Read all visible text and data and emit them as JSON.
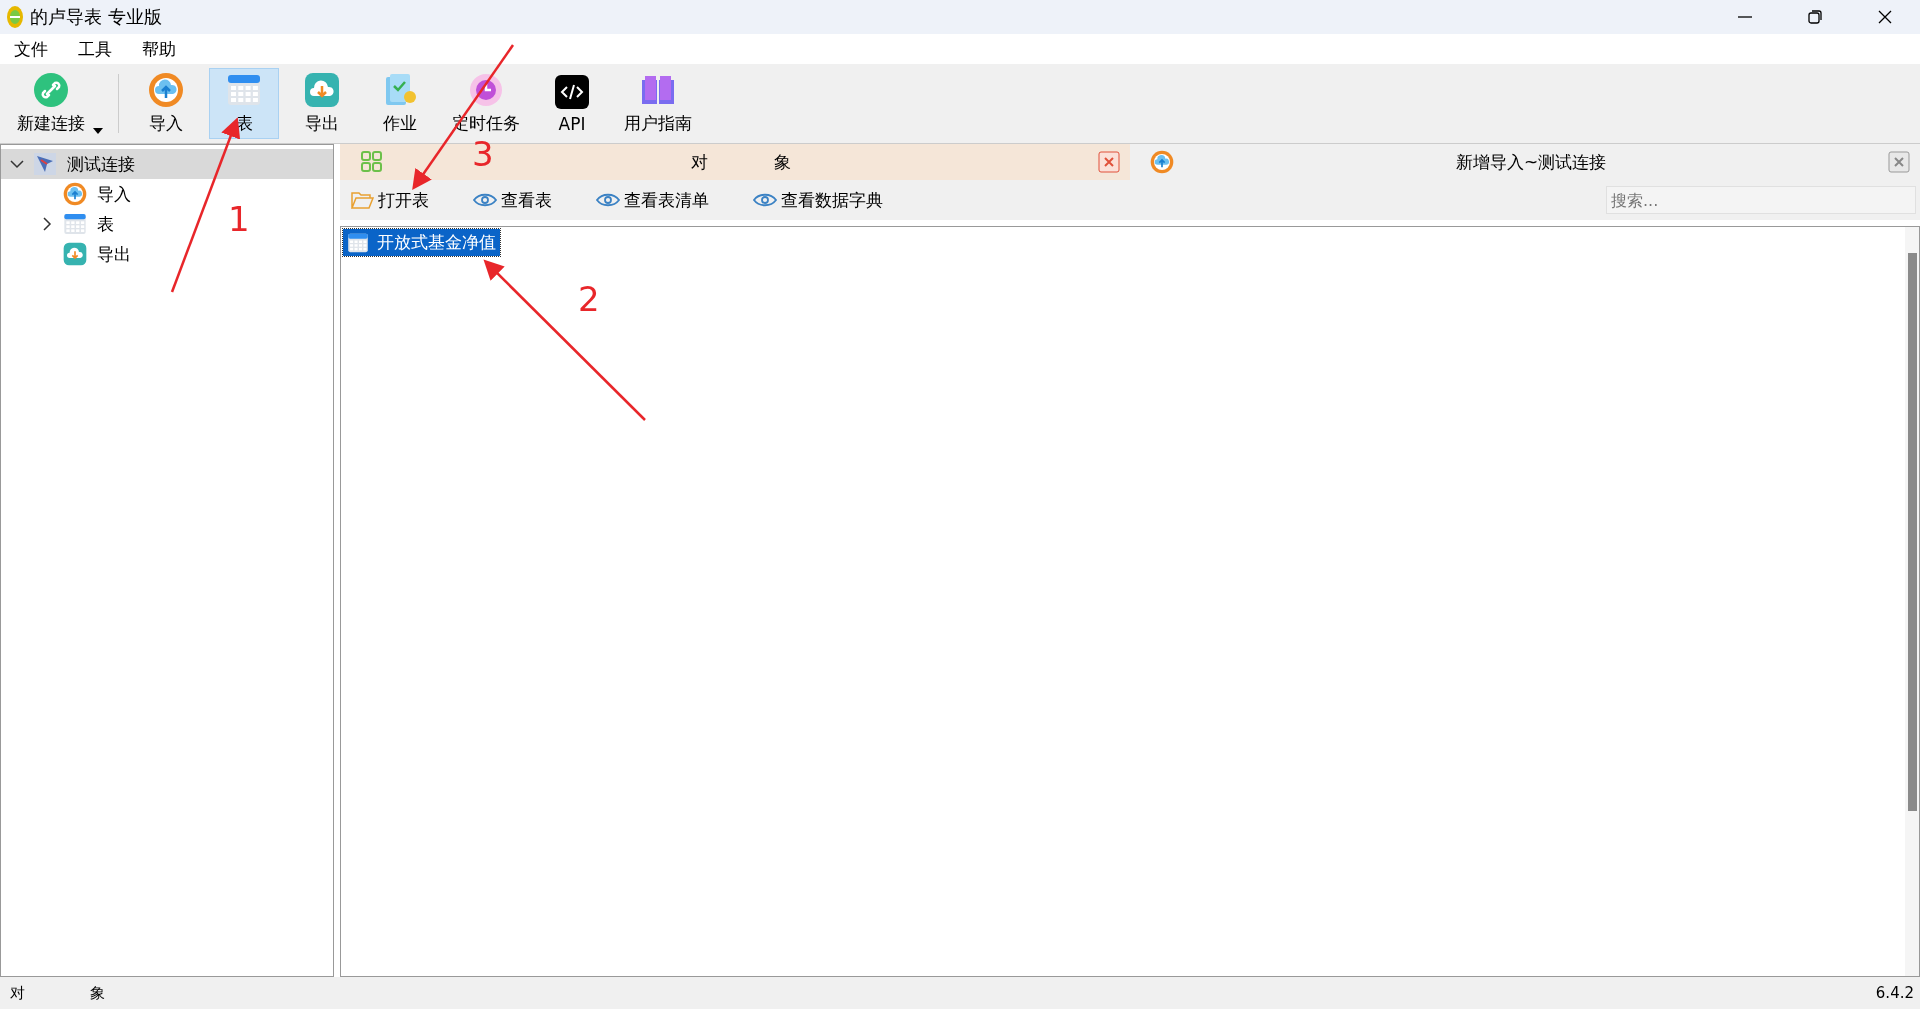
{
  "window": {
    "title": "的卢导表 专业版"
  },
  "menu": [
    "文件",
    "工具",
    "帮助"
  ],
  "toolbar": [
    {
      "label": "新建连接",
      "dropdown": true,
      "selected": false
    },
    {
      "label": "导入",
      "dropdown": false,
      "selected": false
    },
    {
      "label": "表",
      "dropdown": false,
      "selected": true
    },
    {
      "label": "导出",
      "dropdown": false,
      "selected": false
    },
    {
      "label": "作业",
      "dropdown": false,
      "selected": false
    },
    {
      "label": "定时任务",
      "dropdown": false,
      "selected": false
    },
    {
      "label": "API",
      "dropdown": false,
      "selected": false
    },
    {
      "label": "用户指南",
      "dropdown": false,
      "selected": false
    }
  ],
  "tree": [
    {
      "label": "测试连接",
      "expanded": true,
      "selected": true,
      "children": [
        {
          "label": "导入",
          "selected": false
        },
        {
          "label": "表",
          "expanded": false,
          "selected": false
        },
        {
          "label": "导出",
          "selected": false
        }
      ]
    }
  ],
  "tabs": [
    {
      "label": "对 象",
      "selected": true
    },
    {
      "label": "新增导入~测试连接",
      "selected": false
    }
  ],
  "actions": [
    "打开表",
    "查看表",
    "查看表清单",
    "查看数据字典"
  ],
  "search": {
    "placeholder": "搜索..."
  },
  "objects": [
    {
      "label": "开放式基金净值",
      "selected": true
    }
  ],
  "status_bar": {
    "left": "对 象",
    "version": "6.4.2"
  },
  "annotations": [
    "1",
    "2",
    "3"
  ]
}
